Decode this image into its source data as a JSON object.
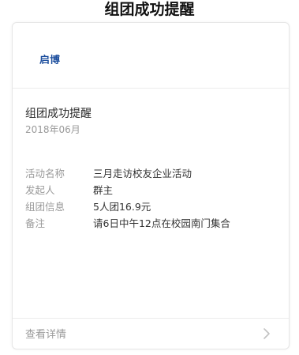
{
  "page": {
    "title": "组团成功提醒"
  },
  "card": {
    "logo_text": "启博",
    "message_title": "组团成功提醒",
    "date": "2018年06月",
    "rows": [
      {
        "label": "活动名称",
        "value": "三月走访校友企业活动"
      },
      {
        "label": "发起人",
        "value": "群主"
      },
      {
        "label": "组团信息",
        "value": "5人团16.9元"
      },
      {
        "label": "备注",
        "value": "请6日中午12点在校园南门集合"
      }
    ],
    "footer_label": "查看详情",
    "footer_icon": "chevron-right-icon"
  },
  "colors": {
    "brand": "#1d4f9e",
    "label_gray": "#9a9a9a",
    "text_dark": "#333333"
  }
}
